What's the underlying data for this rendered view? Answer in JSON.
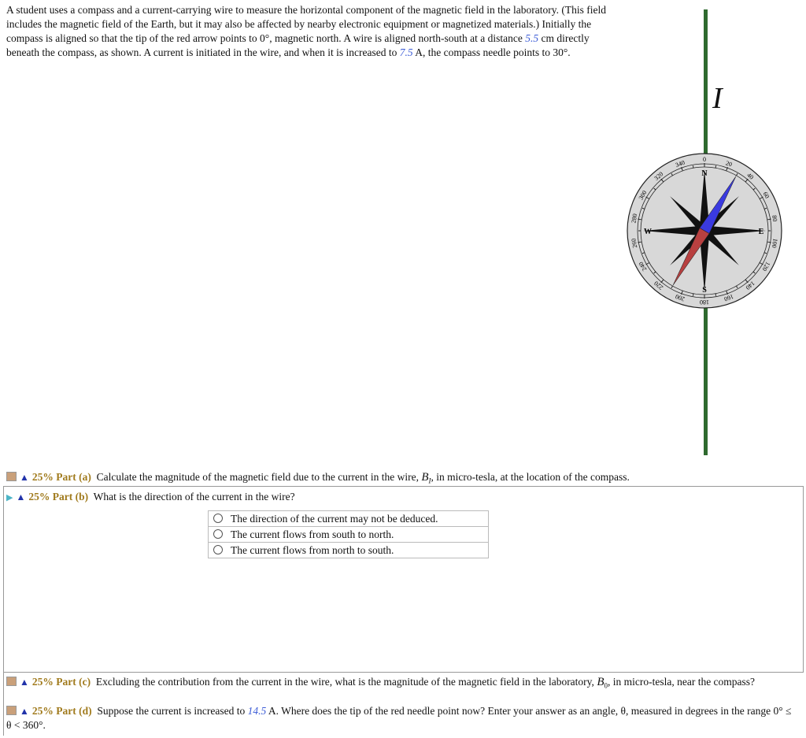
{
  "problem": {
    "text_1": "A student uses a compass and a current-carrying wire to measure the horizontal component of the magnetic field in the laboratory. (This field includes the magnetic field of the Earth, but it may also be affected by nearby electronic equipment or magnetized materials.) Initially the compass is aligned so that the tip of the red arrow points to 0°, magnetic north. A wire is aligned north-south at a distance ",
    "distance": "5.5",
    "text_2": " cm directly beneath the compass, as shown. A current is initiated in the wire, and when it is increased to ",
    "current": "7.5",
    "text_3": " A, the compass needle points to 30°."
  },
  "figure": {
    "current_label": "I",
    "needle_angle_deg": 30,
    "cardinals": [
      "N",
      "E",
      "S",
      "W"
    ],
    "wire_color": "#2f6a2f",
    "needle_north_color": "#3a3ae0",
    "needle_south_color": "#b84040"
  },
  "parts": {
    "a": {
      "percent": "25%",
      "label": "Part (a)",
      "text": "Calculate the magnitude of the magnetic field due to the current in the wire, ",
      "var": "B",
      "sub": "I",
      "text_end": ", in micro-tesla, at the location of the compass."
    },
    "b": {
      "percent": "25%",
      "label": "Part (b)",
      "text": "What is the direction of the current in the wire?",
      "options": [
        "The direction of the current may not be deduced.",
        "The current flows from south to north.",
        "The current flows from north to south."
      ]
    },
    "c": {
      "percent": "25%",
      "label": "Part (c)",
      "text": "Excluding the contribution from the current in the wire, what is the magnitude of the magnetic field in the laboratory, ",
      "var": "B",
      "sub": "0",
      "text_end": ", in micro-tesla, near the compass?"
    },
    "d": {
      "percent": "25%",
      "label": "Part (d)",
      "text_1": "Suppose the current is increased to ",
      "current": "14.5",
      "text_2": " A. Where does the tip of the red needle point now? Enter your answer as an angle, θ, measured in degrees in the range 0° ≤ θ < 360°."
    }
  }
}
